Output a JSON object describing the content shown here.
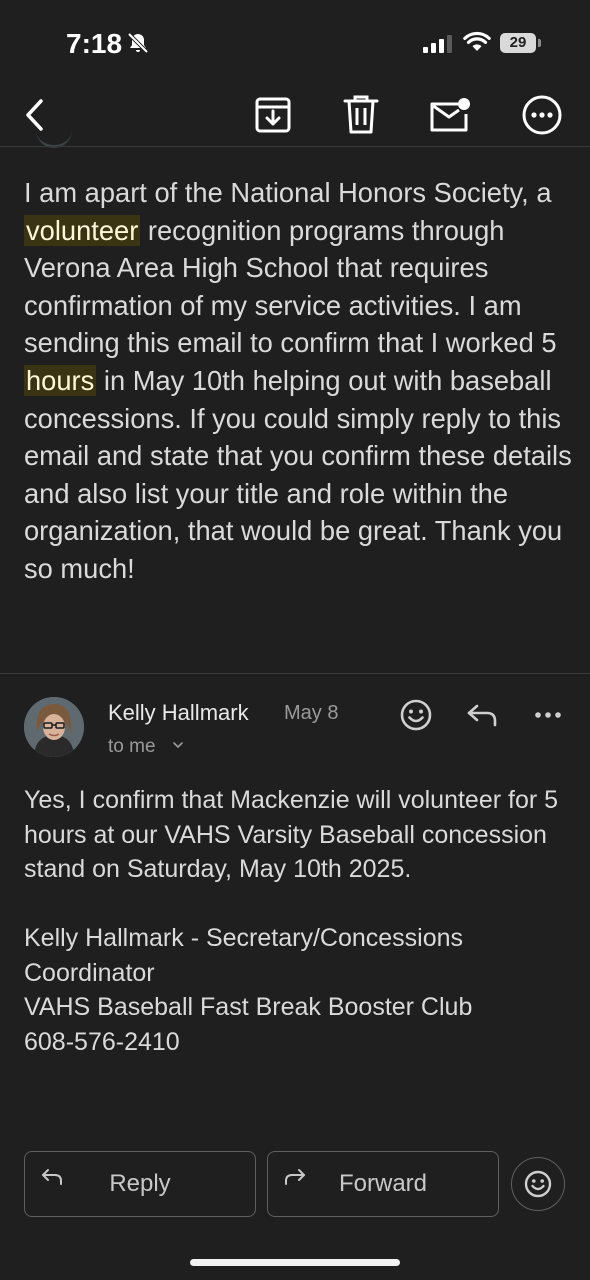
{
  "status_bar": {
    "time": "7:18",
    "battery": "29"
  },
  "icons": {
    "back": "chevron-left-icon",
    "archive": "archive-icon",
    "delete": "trash-icon",
    "unread": "mark-unread-icon",
    "more": "more-icon"
  },
  "message_body": {
    "p1": "I am apart of the National Honors Society, a ",
    "hl1": "volunteer",
    "p2": " recognition programs through Verona Area High School that requires confirmation of my service activities. I am sending this email to confirm that I worked 5 ",
    "hl2": "hours",
    "p3": " in May 10th helping out with baseball concessions. If you could simply reply to this email and state that you confirm these details and also list your title and role within the organization, that would be great. Thank you so much!"
  },
  "reply_message": {
    "sender_name": "Kelly Hallmark",
    "date": "May 8",
    "recipient": "to me",
    "body": "Yes, I confirm that Mackenzie will volunteer for 5 hours at our VAHS Varsity Baseball concession stand on Saturday, May 10th 2025.\n\nKelly Hallmark - Secretary/Concessions Coordinator\nVAHS Baseball Fast Break Booster Club\n608-576-2410"
  },
  "actions": {
    "reply_label": "Reply",
    "forward_label": "Forward"
  },
  "colors": {
    "background": "#1f1f1f",
    "text": "#dadada",
    "highlight_bg": "#3b3412",
    "muted": "#9a9a9a"
  }
}
